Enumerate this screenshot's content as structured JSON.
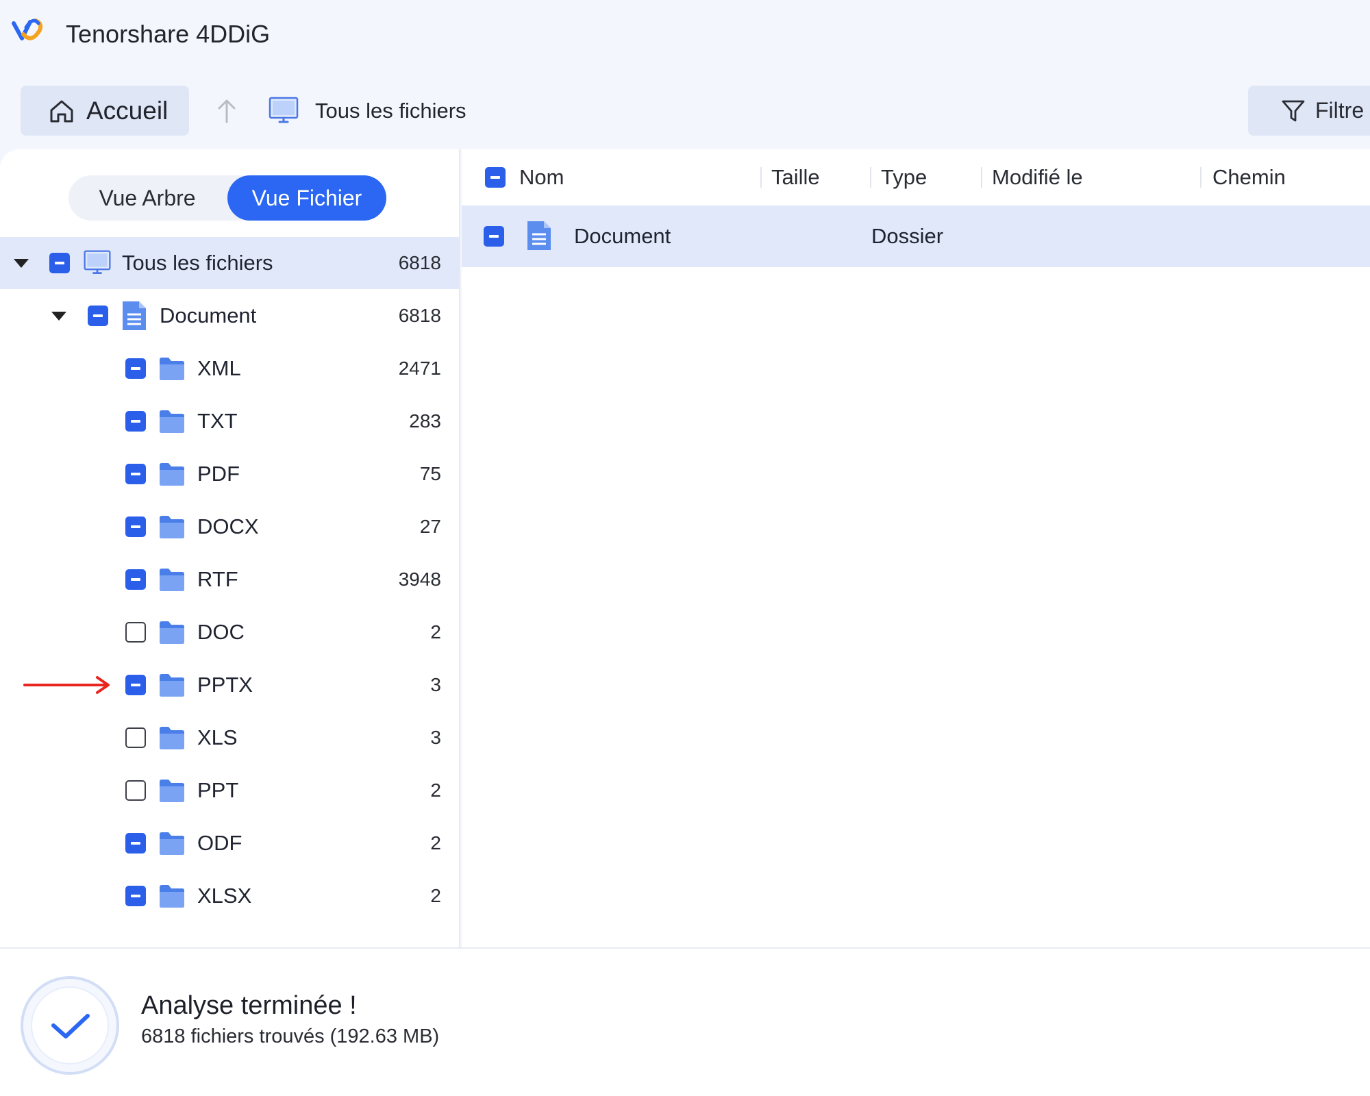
{
  "app": {
    "title": "Tenorshare 4DDiG",
    "logo_icon": "4ddig-logo-icon"
  },
  "toolbar": {
    "home_label": "Accueil",
    "home_icon": "home-icon",
    "up_icon": "arrow-up-icon",
    "breadcrumb_icon": "computer-icon",
    "breadcrumb": "Tous les fichiers",
    "filter_label": "Filtre",
    "filter_icon": "filter-icon"
  },
  "view_toggle": {
    "tree": "Vue Arbre",
    "file": "Vue Fichier",
    "active": "file"
  },
  "tree": {
    "root": {
      "label": "Tous les fichiers",
      "count": "6818",
      "check": "partial",
      "expanded": true,
      "icon": "computer-icon"
    },
    "document": {
      "label": "Document",
      "count": "6818",
      "check": "partial",
      "expanded": true,
      "icon": "document-icon"
    },
    "children": [
      {
        "label": "XML",
        "count": "2471",
        "check": "partial"
      },
      {
        "label": "TXT",
        "count": "283",
        "check": "partial"
      },
      {
        "label": "PDF",
        "count": "75",
        "check": "partial"
      },
      {
        "label": "DOCX",
        "count": "27",
        "check": "partial"
      },
      {
        "label": "RTF",
        "count": "3948",
        "check": "partial"
      },
      {
        "label": "DOC",
        "count": "2",
        "check": "empty"
      },
      {
        "label": "PPTX",
        "count": "3",
        "check": "partial"
      },
      {
        "label": "XLS",
        "count": "3",
        "check": "empty"
      },
      {
        "label": "PPT",
        "count": "2",
        "check": "empty"
      },
      {
        "label": "ODF",
        "count": "2",
        "check": "partial"
      },
      {
        "label": "XLSX",
        "count": "2",
        "check": "partial"
      }
    ]
  },
  "table": {
    "columns": [
      "Nom",
      "Taille",
      "Type",
      "Modifié le",
      "Chemin"
    ],
    "rows": [
      {
        "name": "Document",
        "size": "",
        "type": "Dossier",
        "modified": "",
        "path": "",
        "check": "partial"
      }
    ]
  },
  "annotation": {
    "arrow_target": "PPTX",
    "color": "#e8261f"
  },
  "status": {
    "title": "Analyse terminée !",
    "subtitle": "6818 fichiers trouvés (192.63 MB)",
    "icon": "check-circle-icon"
  },
  "colors": {
    "accent": "#2b67f2",
    "selection": "#e0e8fa",
    "folder": "#5b8def"
  }
}
